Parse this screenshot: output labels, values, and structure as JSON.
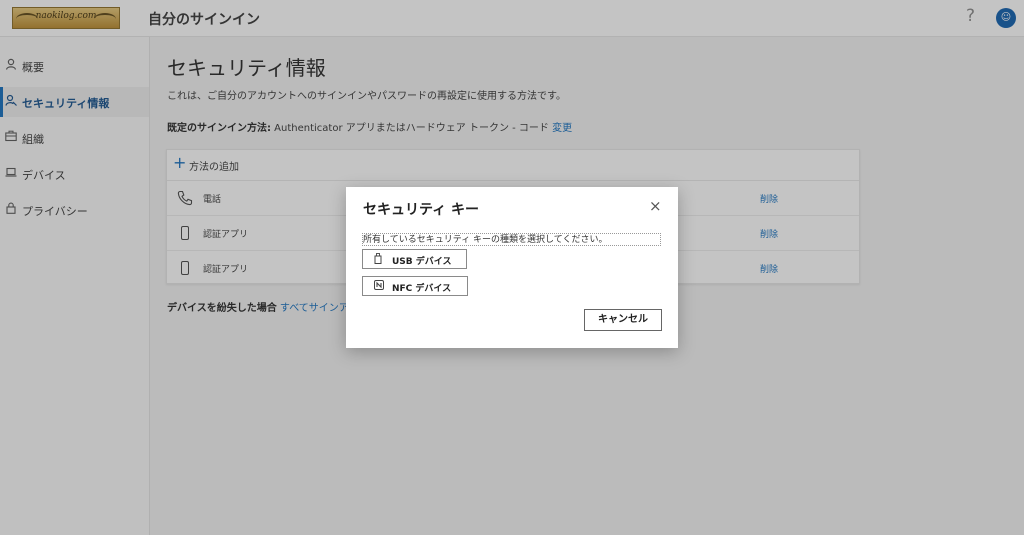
{
  "header": {
    "logo_text": "naokilog.com",
    "app_title": "自分のサインイン",
    "help_icon": "question-icon",
    "avatar_icon": "user-icon",
    "help_glyph": "?",
    "avatar_glyph": "☺"
  },
  "sidebar": {
    "items": [
      {
        "label": "概要",
        "icon": "person-icon",
        "glyph": "ᴿ"
      },
      {
        "label": "セキュリティ情報",
        "icon": "security-key-icon",
        "glyph": "⚷"
      },
      {
        "label": "組織",
        "icon": "briefcase-icon",
        "glyph": "▤"
      },
      {
        "label": "デバイス",
        "icon": "laptop-icon",
        "glyph": "▭"
      },
      {
        "label": "プライバシー",
        "icon": "lock-icon",
        "glyph": "🔒"
      }
    ],
    "active_index": 1
  },
  "main": {
    "title": "セキュリティ情報",
    "description": "これは、ご自分のアカウントへのサインインやパスワードの再設定に使用する方法です。",
    "default_label": "既定のサインイン方法:",
    "default_value": " Authenticator アプリまたはハードウェア トークン - コード ",
    "default_change_link": "変更",
    "add_method": "方法の追加",
    "methods": [
      {
        "label": "電話",
        "icon": "phone-icon",
        "delete": "削除"
      },
      {
        "label": "認証アプリ",
        "icon": "mobile-device-icon",
        "delete": "削除"
      },
      {
        "label": "認証アプリ",
        "icon": "mobile-device-icon",
        "delete": "削除"
      }
    ],
    "lost_label": "デバイスを紛失した場合",
    "lost_link": "すべてサインア"
  },
  "dialog": {
    "title": "セキュリティ キー",
    "close_glyph": "×",
    "description": "所有しているセキュリティ キーの種類を選択してください。",
    "usb_label": "USB デバイス",
    "nfc_label": "NFC デバイス",
    "cancel_label": "キャンセル"
  },
  "colors": {
    "accent": "#0f6cbd",
    "avatar_bg": "#0b5cad"
  }
}
